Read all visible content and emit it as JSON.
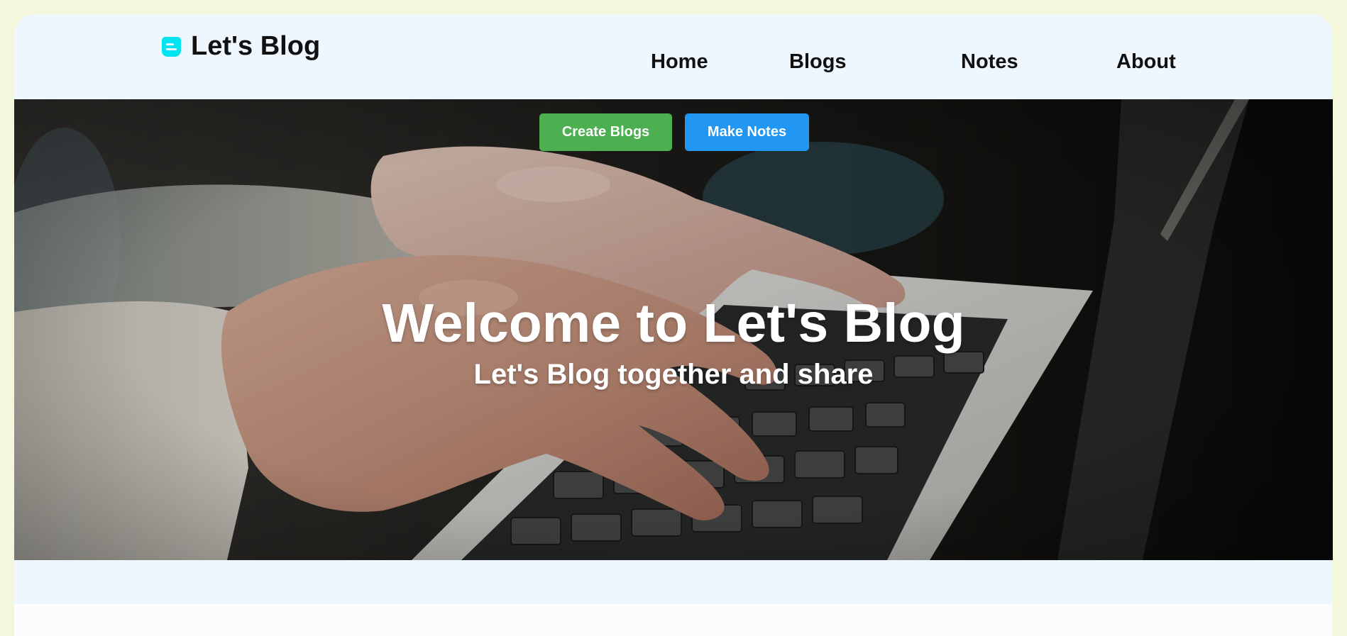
{
  "brand": {
    "name": "Let's Blog",
    "icon": "blog-logo-icon",
    "icon_color": "#00e5f0"
  },
  "nav": {
    "items": [
      {
        "label": "Home"
      },
      {
        "label": "Blogs"
      },
      {
        "label": "Notes"
      },
      {
        "label": "About"
      }
    ]
  },
  "hero": {
    "title": "Welcome to Let's Blog",
    "subtitle": "Let's Blog together and share",
    "image": "hands-typing-on-laptop",
    "buttons": {
      "create_blogs": "Create Blogs",
      "make_notes": "Make Notes"
    }
  },
  "colors": {
    "page_background": "#f5f7dc",
    "header_background": "#eef7fe",
    "create_button": "#4caf50",
    "make_notes_button": "#2196f3"
  }
}
